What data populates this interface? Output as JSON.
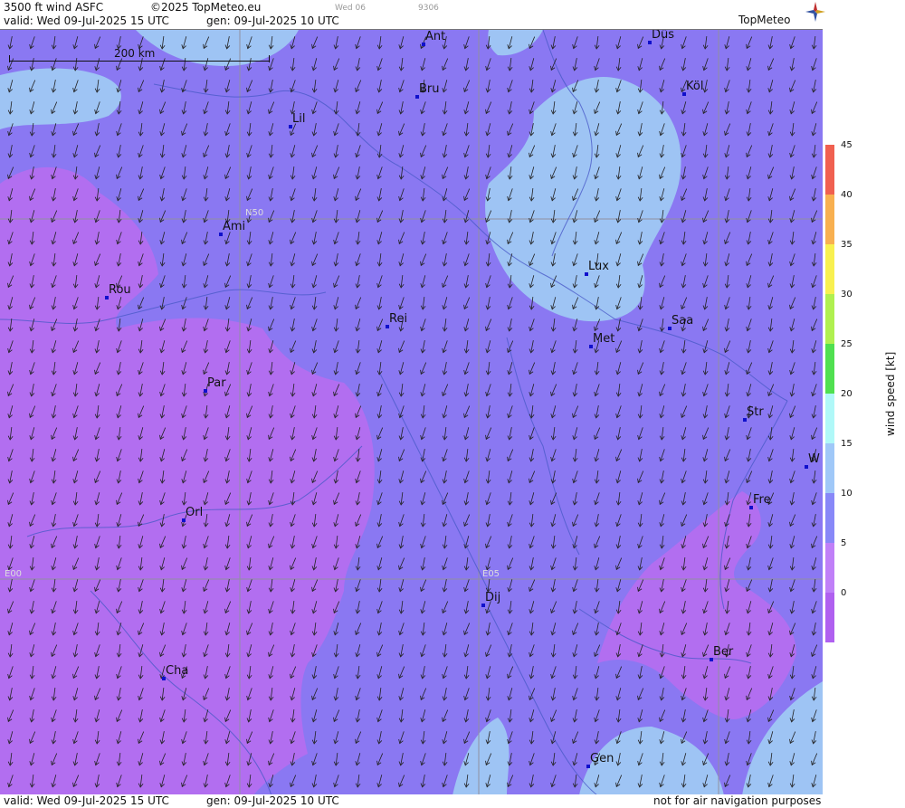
{
  "header": {
    "product": "3500 ft wind ASFC",
    "copyright": "©2025 TopMeteo.eu",
    "day_tab": "Wed 06",
    "code": "9306",
    "valid": "valid:  Wed  09-Jul-2025  15 UTC",
    "generated": "gen: 09-Jul-2025 10 UTC",
    "logo": "TopMeteo"
  },
  "scale": {
    "label": "200 km"
  },
  "grid_labels": {
    "lat": "N50",
    "lon0": "E00",
    "lon5": "E05"
  },
  "cities": [
    {
      "label": "Ant"
    },
    {
      "label": "Düs"
    },
    {
      "label": "Bru"
    },
    {
      "label": "Köl"
    },
    {
      "label": "Lil"
    },
    {
      "label": "Ami"
    },
    {
      "label": "Lux"
    },
    {
      "label": "Rou"
    },
    {
      "label": "Rei"
    },
    {
      "label": "Saa"
    },
    {
      "label": "Met"
    },
    {
      "label": "Par"
    },
    {
      "label": "Str"
    },
    {
      "label": "W"
    },
    {
      "label": "Fre"
    },
    {
      "label": "Orl"
    },
    {
      "label": "Dij"
    },
    {
      "label": "Ber"
    },
    {
      "label": "Cha"
    },
    {
      "label": "Gen"
    }
  ],
  "legend": {
    "title": "wind speed [kt]",
    "ticks": [
      "45",
      "40",
      "35",
      "30",
      "25",
      "20",
      "15",
      "10",
      "5",
      "0"
    ],
    "colors": [
      "#f06050",
      "#f8b050",
      "#f8f050",
      "#b0f050",
      "#50e050",
      "#b0f8f8",
      "#a0c8f8",
      "#8888f8",
      "#c080f8",
      "#b060f0"
    ]
  },
  "map_colors": {
    "base": "#8a78f2",
    "calm": "#b26ef0",
    "moderate": "#9ec4f4"
  },
  "footer": {
    "valid": "valid:  Wed  09-Jul-2025  15 UTC",
    "generated": "gen: 09-Jul-2025 10 UTC",
    "disclaimer": "not for air navigation purposes"
  }
}
